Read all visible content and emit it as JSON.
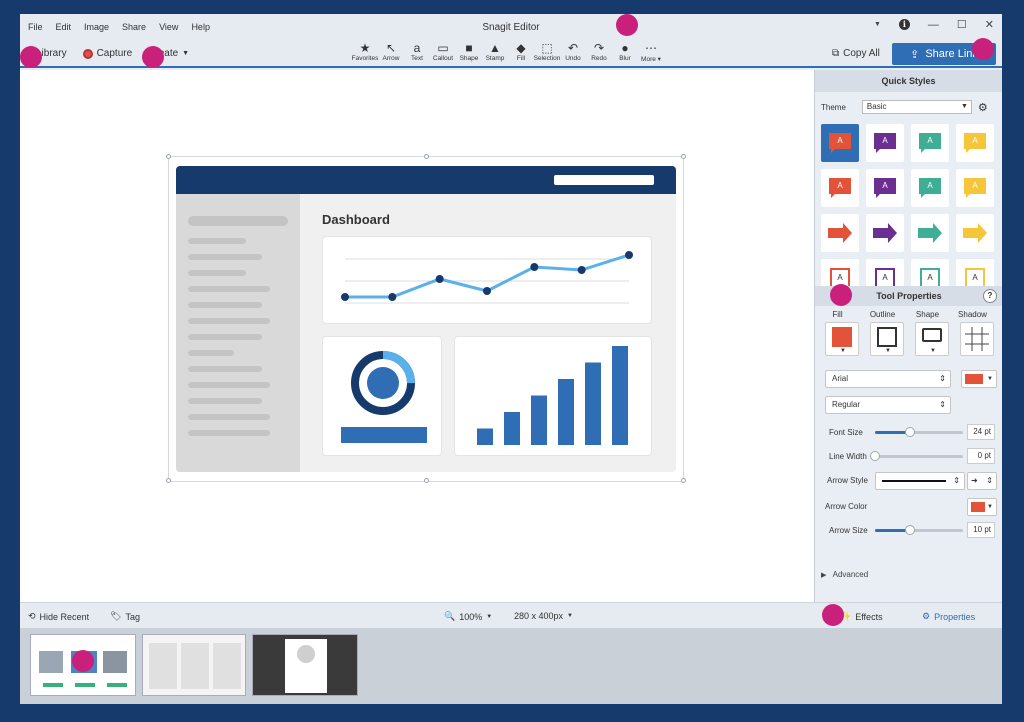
{
  "window": {
    "title": "Snagit Editor",
    "menus": [
      "File",
      "Edit",
      "Image",
      "Share",
      "View",
      "Help"
    ]
  },
  "toolbar": {
    "library_label": "Library",
    "capture_label": "Capture",
    "create_label": "Create",
    "tools": [
      {
        "label": "Favorites",
        "icon": "star-icon",
        "glyph": "★"
      },
      {
        "label": "Arrow",
        "icon": "arrow-icon",
        "glyph": "↖"
      },
      {
        "label": "Text",
        "icon": "text-icon",
        "glyph": "a"
      },
      {
        "label": "Callout",
        "icon": "callout-icon",
        "glyph": "▭"
      },
      {
        "label": "Shape",
        "icon": "shape-icon",
        "glyph": "■"
      },
      {
        "label": "Stamp",
        "icon": "stamp-icon",
        "glyph": "▲"
      },
      {
        "label": "Fill",
        "icon": "fill-icon",
        "glyph": "◆"
      },
      {
        "label": "Selection",
        "icon": "selection-icon",
        "glyph": "⬚"
      },
      {
        "label": "Undo",
        "icon": "undo-icon",
        "glyph": "↶"
      },
      {
        "label": "Redo",
        "icon": "redo-icon",
        "glyph": "↷"
      },
      {
        "label": "Blur",
        "icon": "blur-icon",
        "glyph": "●"
      },
      {
        "label": "More ▾",
        "icon": "more-icon",
        "glyph": "⋯"
      }
    ],
    "copy_all_label": "Copy All",
    "share_link_label": "Share Link"
  },
  "canvas": {
    "dashboard_title": "Dashboard",
    "line_chart_y": [
      2,
      2,
      5,
      3,
      7,
      6.5,
      9
    ],
    "bar_heights": [
      1,
      2,
      3,
      4,
      5,
      6
    ],
    "donut_fraction": 0.25
  },
  "panel": {
    "quick_styles_title": "Quick Styles",
    "theme_label": "Theme",
    "theme_value": "Basic",
    "style_colors": [
      "#e2533a",
      "#6b2f91",
      "#3fae94",
      "#f5c53a"
    ],
    "tool_properties_title": "Tool Properties",
    "prop_labels": [
      "Fill",
      "Outline",
      "Shape",
      "Shadow"
    ],
    "fill_color": "#e2533a",
    "font_value": "Arial",
    "weight_value": "Regular",
    "font_size": {
      "label": "Font Size",
      "value": "24 pt",
      "level": 0.4
    },
    "line_width": {
      "label": "Line Width",
      "value": "0 pt",
      "level": 0.0
    },
    "arrow_style_label": "Arrow Style",
    "arrow_color_label": "Arrow Color",
    "arrow_size": {
      "label": "Arrow Size",
      "value": "10 pt",
      "level": 0.4
    },
    "advanced_label": "Advanced"
  },
  "bottombar": {
    "hide_recent_label": "Hide Recent",
    "tag_label": "Tag",
    "zoom_value": "100%",
    "dimensions_value": "280 x 400px",
    "effects_label": "Effects",
    "properties_label": "Properties"
  },
  "colors": {
    "accent": "#2f6db5",
    "frame": "#163a6b",
    "marker": "#c9207c"
  }
}
